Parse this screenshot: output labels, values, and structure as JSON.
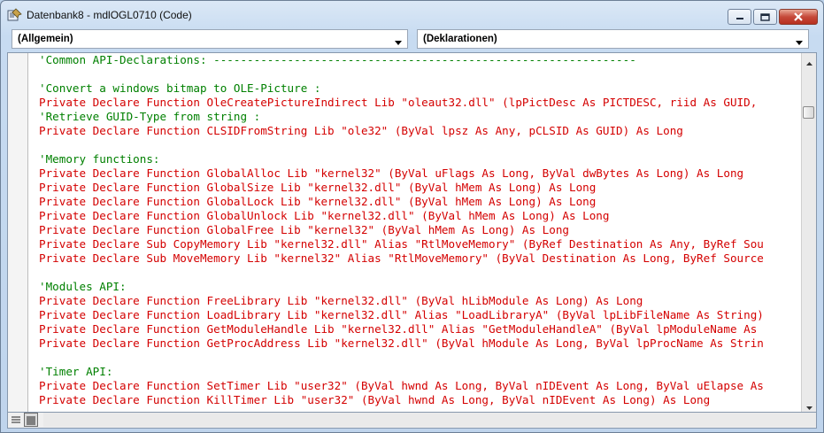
{
  "window": {
    "title": "Datenbank8 - mdlOGL0710 (Code)"
  },
  "combos": {
    "object": "(Allgemein)",
    "procedure": "(Deklarationen)"
  },
  "code_lines": [
    {
      "text": "'Common API-Declarations: ---------------------------------------------------------------",
      "type": "comment"
    },
    {
      "text": "",
      "type": "blank"
    },
    {
      "text": "'Convert a windows bitmap to OLE-Picture :",
      "type": "comment"
    },
    {
      "text": "Private Declare Function OleCreatePictureIndirect Lib \"oleaut32.dll\" (lpPictDesc As PICTDESC, riid As GUID,",
      "type": "code"
    },
    {
      "text": "'Retrieve GUID-Type from string :",
      "type": "comment"
    },
    {
      "text": "Private Declare Function CLSIDFromString Lib \"ole32\" (ByVal lpsz As Any, pCLSID As GUID) As Long",
      "type": "code"
    },
    {
      "text": "",
      "type": "blank"
    },
    {
      "text": "'Memory functions:",
      "type": "comment"
    },
    {
      "text": "Private Declare Function GlobalAlloc Lib \"kernel32\" (ByVal uFlags As Long, ByVal dwBytes As Long) As Long",
      "type": "code"
    },
    {
      "text": "Private Declare Function GlobalSize Lib \"kernel32.dll\" (ByVal hMem As Long) As Long",
      "type": "code"
    },
    {
      "text": "Private Declare Function GlobalLock Lib \"kernel32.dll\" (ByVal hMem As Long) As Long",
      "type": "code"
    },
    {
      "text": "Private Declare Function GlobalUnlock Lib \"kernel32.dll\" (ByVal hMem As Long) As Long",
      "type": "code"
    },
    {
      "text": "Private Declare Function GlobalFree Lib \"kernel32\" (ByVal hMem As Long) As Long",
      "type": "code"
    },
    {
      "text": "Private Declare Sub CopyMemory Lib \"kernel32.dll\" Alias \"RtlMoveMemory\" (ByRef Destination As Any, ByRef Sou",
      "type": "code"
    },
    {
      "text": "Private Declare Sub MoveMemory Lib \"kernel32\" Alias \"RtlMoveMemory\" (ByVal Destination As Long, ByRef Source",
      "type": "code"
    },
    {
      "text": "",
      "type": "blank"
    },
    {
      "text": "'Modules API:",
      "type": "comment"
    },
    {
      "text": "Private Declare Function FreeLibrary Lib \"kernel32.dll\" (ByVal hLibModule As Long) As Long",
      "type": "code"
    },
    {
      "text": "Private Declare Function LoadLibrary Lib \"kernel32.dll\" Alias \"LoadLibraryA\" (ByVal lpLibFileName As String)",
      "type": "code"
    },
    {
      "text": "Private Declare Function GetModuleHandle Lib \"kernel32.dll\" Alias \"GetModuleHandleA\" (ByVal lpModuleName As",
      "type": "code"
    },
    {
      "text": "Private Declare Function GetProcAddress Lib \"kernel32.dll\" (ByVal hModule As Long, ByVal lpProcName As Strin",
      "type": "code"
    },
    {
      "text": "",
      "type": "blank"
    },
    {
      "text": "'Timer API:",
      "type": "comment"
    },
    {
      "text": "Private Declare Function SetTimer Lib \"user32\" (ByVal hwnd As Long, ByVal nIDEvent As Long, ByVal uElapse As",
      "type": "code"
    },
    {
      "text": "Private Declare Function KillTimer Lib \"user32\" (ByVal hwnd As Long, ByVal nIDEvent As Long) As Long",
      "type": "code"
    }
  ],
  "colors": {
    "keyword_code": "#d40000",
    "comment": "#008000"
  },
  "icons": {
    "app": "vba-module-icon",
    "minimize": "minimize-icon",
    "maximize": "maximize-icon",
    "close": "close-icon",
    "dropdown": "chevron-down-icon"
  }
}
